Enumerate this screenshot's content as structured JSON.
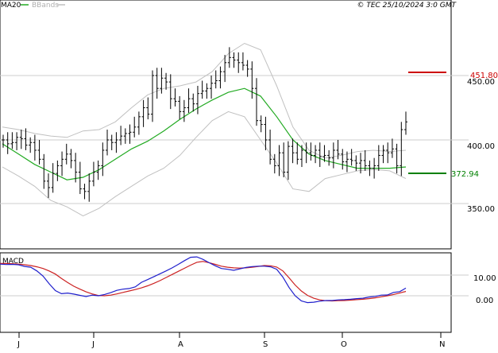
{
  "header": {
    "ma_label": "MA20",
    "bb_label": "BBands",
    "copyright": "© TEC 25/10/2024 3:0 GMT"
  },
  "price_axis": {
    "ticks": [
      {
        "value": 450,
        "label": "450.00"
      },
      {
        "value": 400,
        "label": "400.00"
      },
      {
        "value": 350,
        "label": "350.00"
      }
    ]
  },
  "levels": {
    "resistance": {
      "value": 451.8,
      "label": "451.80",
      "color": "#cc0000"
    },
    "support": {
      "value": 372.94,
      "label": "372.94",
      "color": "#008000"
    }
  },
  "macd": {
    "label": "MACD",
    "ticks": [
      {
        "value": 10,
        "label": "10.00"
      },
      {
        "value": 0,
        "label": "0.00"
      }
    ]
  },
  "months": [
    "J",
    "J",
    "A",
    "S",
    "O",
    "N"
  ],
  "colors": {
    "price_bars": "#000000",
    "ma": "#22aa22",
    "bbands": "#c0c0c0",
    "macd_line": "#1f1fcc",
    "signal_line": "#cc2222",
    "grid": "#cccccc"
  },
  "chart_data": [
    {
      "type": "line",
      "title": "",
      "series_kind": "ohlc-bars-with-ma-and-bollinger",
      "x_categories": [
        "J",
        "J",
        "A",
        "S",
        "O",
        "N"
      ],
      "ylim": [
        325,
        480
      ],
      "series": [
        {
          "name": "MA20",
          "values": [
            397,
            389,
            381,
            375,
            369,
            371,
            377,
            385,
            393,
            399,
            407,
            416,
            424,
            431,
            437,
            440,
            434,
            418,
            400,
            389,
            384,
            381,
            378,
            378,
            378,
            379
          ]
        },
        {
          "values": [
            410,
            408,
            405,
            403,
            402,
            407,
            408,
            414,
            425,
            435,
            440,
            442,
            445,
            453,
            467,
            475,
            470,
            442,
            410,
            392,
            386,
            388,
            391,
            392,
            391,
            392
          ]
        },
        {
          "values": [
            379,
            372,
            364,
            353,
            348,
            341,
            347,
            356,
            364,
            372,
            378,
            388,
            402,
            415,
            422,
            418,
            400,
            382,
            362,
            360,
            370,
            373,
            376,
            377,
            376,
            370
          ]
        }
      ],
      "price_closes": [
        400,
        397,
        398,
        402,
        401,
        396,
        398,
        392,
        385,
        368,
        363,
        374,
        380,
        385,
        389,
        384,
        375,
        362,
        360,
        368,
        375,
        380,
        392,
        400,
        398,
        400,
        403,
        405,
        406,
        410,
        418,
        425,
        420,
        450,
        440,
        448,
        445,
        432,
        430,
        422,
        425,
        432,
        428,
        436,
        438,
        440,
        444,
        446,
        453,
        460,
        464,
        462,
        460,
        458,
        455,
        440,
        415,
        412,
        400,
        385,
        380,
        390,
        375,
        395,
        390,
        385,
        392,
        390,
        388,
        392,
        387,
        388,
        386,
        392,
        389,
        383,
        385,
        384,
        382,
        384,
        380,
        378,
        380,
        388,
        392,
        390,
        393,
        380,
        408,
        414
      ]
    },
    {
      "type": "line",
      "title": "MACD",
      "ylim": [
        -5,
        24
      ],
      "series": [
        {
          "values": [
            15.3,
            15.1,
            15.2,
            15.0,
            14.2,
            13.8,
            12.0,
            9.5,
            5.8,
            2.5,
            1.0,
            1.3,
            0.8,
            0.2,
            -0.4,
            0.3,
            0.0,
            0.6,
            1.5,
            2.6,
            3.2,
            3.5,
            4.3,
            6.5,
            7.8,
            9.2,
            10.6,
            12.0,
            13.5,
            15.2,
            17.0,
            18.6,
            18.8,
            17.6,
            16.0,
            14.5,
            13.2,
            12.8,
            12.3,
            13.0,
            13.7,
            14.1,
            14.3,
            14.3,
            14.0,
            12.8,
            9.0,
            4.0,
            0.0,
            -2.5,
            -3.3,
            -3.1,
            -2.6,
            -2.3,
            -2.3,
            -2.0,
            -1.9,
            -1.7,
            -1.4,
            -1.2,
            -0.6,
            -0.3,
            0.3,
            0.4,
            1.6,
            2.0,
            3.7
          ]
        },
        {
          "values": [
            15.6,
            15.6,
            15.5,
            15.3,
            15.0,
            14.6,
            14.0,
            13.2,
            12.0,
            10.5,
            8.4,
            6.4,
            4.6,
            3.2,
            1.9,
            0.9,
            0.1,
            0.0,
            0.3,
            0.9,
            1.6,
            2.3,
            3.0,
            3.8,
            4.8,
            6.0,
            7.3,
            8.8,
            10.3,
            11.8,
            13.3,
            14.8,
            16.2,
            16.6,
            16.0,
            15.2,
            14.3,
            13.8,
            13.5,
            13.4,
            13.5,
            13.8,
            14.2,
            14.6,
            14.5,
            13.9,
            12.0,
            8.7,
            5.2,
            2.3,
            0.2,
            -1.2,
            -2.0,
            -2.4,
            -2.5,
            -2.4,
            -2.3,
            -2.1,
            -1.9,
            -1.7,
            -1.4,
            -1.0,
            -0.5,
            0.0,
            0.6,
            1.3,
            2.1
          ]
        }
      ],
      "ticks": [
        10,
        0
      ]
    }
  ]
}
